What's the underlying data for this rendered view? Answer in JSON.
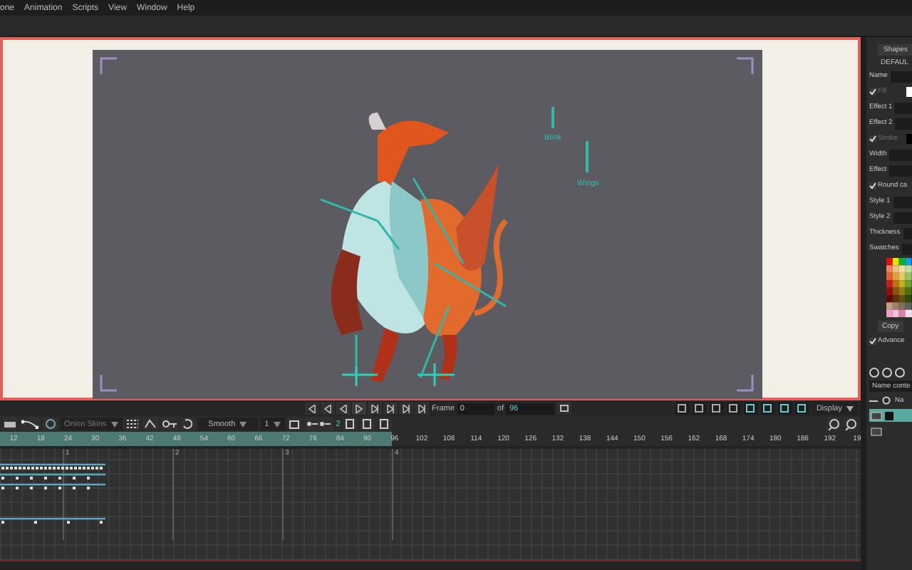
{
  "menu": [
    {
      "label": "one"
    },
    {
      "label": "Animation"
    },
    {
      "label": "Scripts"
    },
    {
      "label": "View"
    },
    {
      "label": "Window"
    },
    {
      "label": "Help"
    }
  ],
  "stage": {
    "bones": [
      {
        "label": "Blink"
      },
      {
        "label": "Wings"
      }
    ]
  },
  "playback": {
    "frame_label": "Frame",
    "frame": "0",
    "of_label": "of",
    "total": "96",
    "display": "Display"
  },
  "toolbar": {
    "onion_skins": "Onion Skins",
    "interpolation": "Smooth",
    "step": "1",
    "keys": "2"
  },
  "ruler": {
    "ticks": [
      "12",
      "18",
      "24",
      "30",
      "36",
      "42",
      "48",
      "54",
      "60",
      "66",
      "72",
      "78",
      "84",
      "90",
      "96",
      "102",
      "108",
      "114",
      "120",
      "126",
      "132",
      "138",
      "144",
      "150",
      "156",
      "162",
      "168",
      "174",
      "180",
      "186",
      "192",
      "19"
    ],
    "range": {
      "level": 0.455
    }
  },
  "graph": {
    "seconds": [
      "1",
      "2",
      "3",
      "4"
    ]
  },
  "panel": {
    "tab": "Shapes",
    "preset": "DEFAUL",
    "rows": [
      {
        "kind": "field",
        "label": "Name"
      },
      {
        "kind": "check",
        "label": "Fill",
        "checked": true,
        "disabled": true,
        "color": "#ffffff"
      },
      {
        "kind": "field",
        "label": "Effect 1"
      },
      {
        "kind": "field",
        "label": "Effect 2"
      },
      {
        "kind": "check",
        "label": "Stroke",
        "checked": true,
        "disabled": true,
        "color": "#000000"
      },
      {
        "kind": "field",
        "label": "Width"
      },
      {
        "kind": "field",
        "label": "Effect"
      },
      {
        "kind": "check",
        "label": "Round ca",
        "checked": true,
        "disabled": false
      },
      {
        "kind": "field",
        "label": "Style 1"
      },
      {
        "kind": "field",
        "label": "Style 2"
      },
      {
        "kind": "field",
        "label": "Thickness"
      },
      {
        "kind": "field",
        "label": "Swatches"
      }
    ],
    "copy": "Copy",
    "advanced": {
      "label": "Advance",
      "checked": true
    },
    "layers_header": "Name conte",
    "column_header": "Na",
    "layers": [
      {
        "selected": true
      },
      {
        "selected": false
      }
    ]
  }
}
